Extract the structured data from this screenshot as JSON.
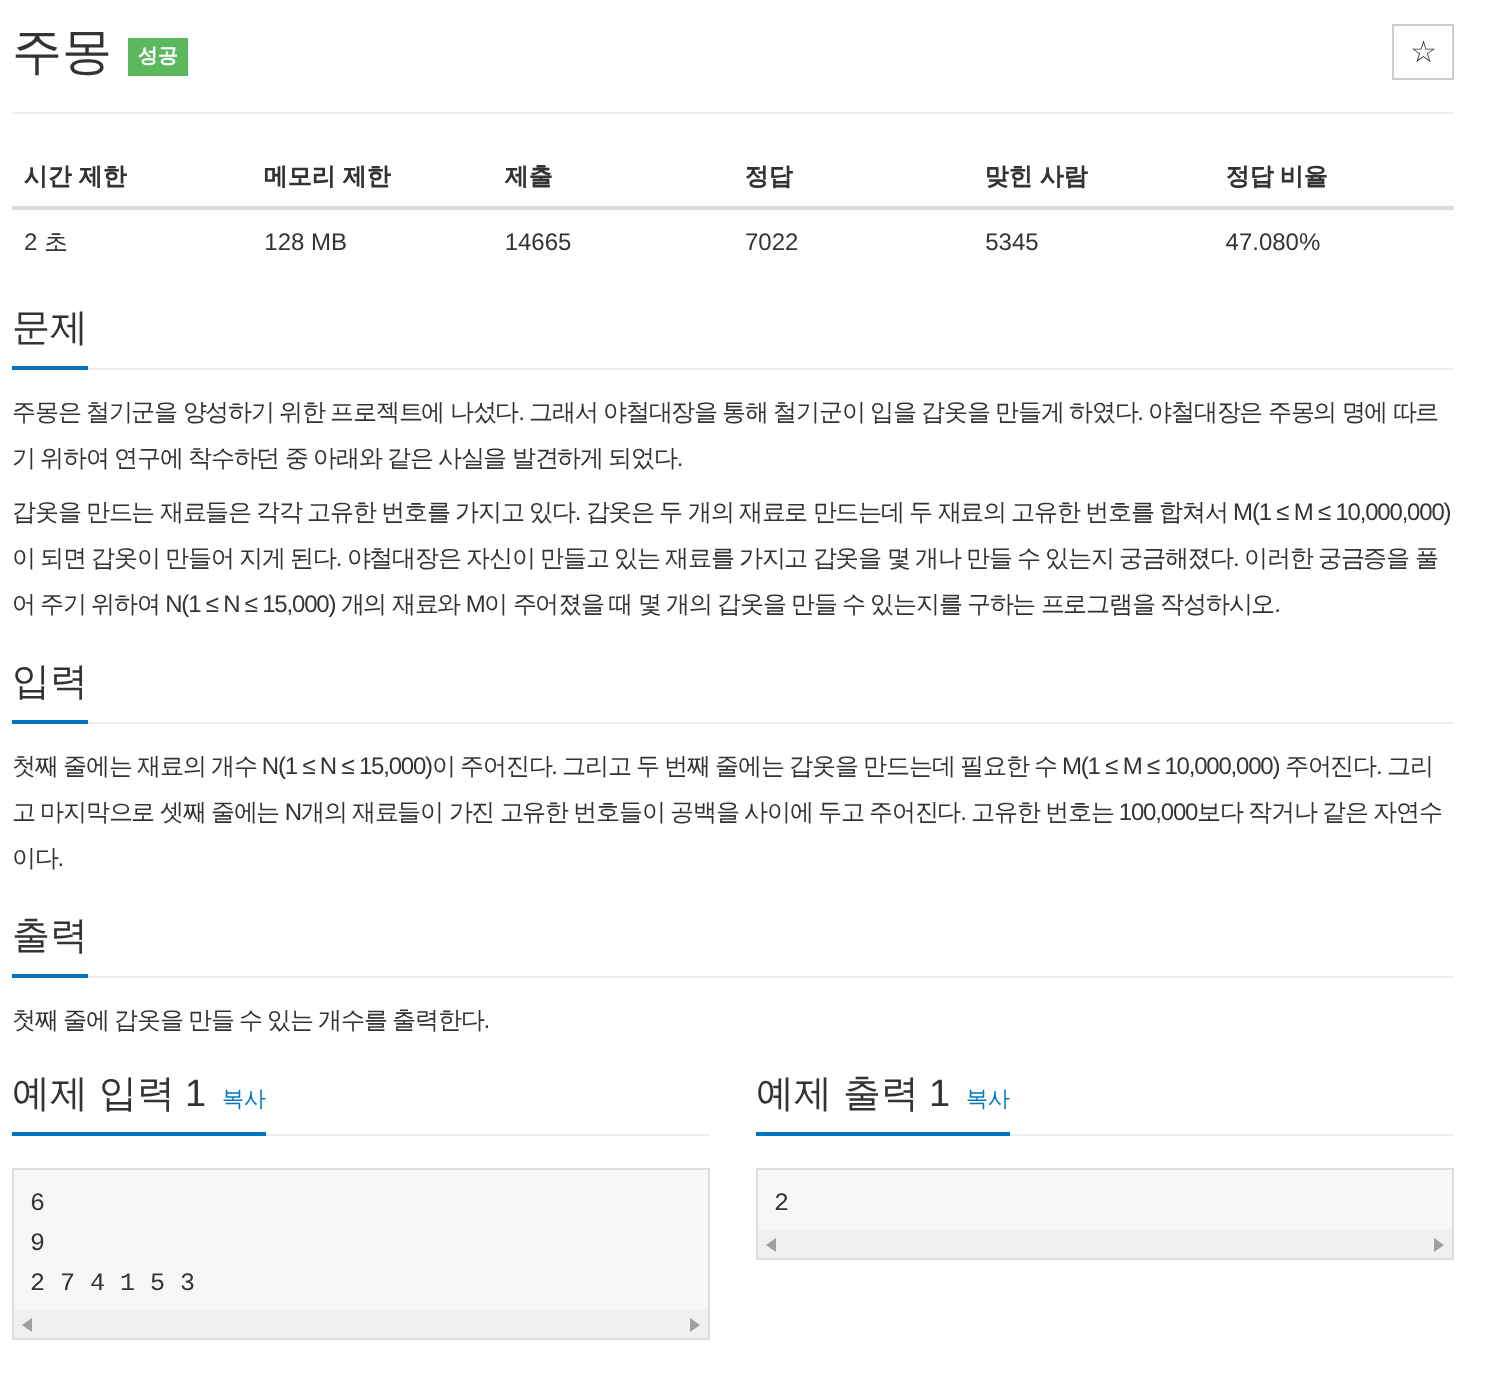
{
  "problem": {
    "title": "주몽",
    "badge": "성공",
    "star": "☆"
  },
  "stats": {
    "columns": [
      "시간 제한",
      "메모리 제한",
      "제출",
      "정답",
      "맞힌 사람",
      "정답 비율"
    ],
    "values": [
      "2 초",
      "128 MB",
      "14665",
      "7022",
      "5345",
      "47.080%"
    ]
  },
  "sections": [
    {
      "heading": "문제",
      "paragraphs": [
        "주몽은 철기군을 양성하기 위한 프로젝트에 나섰다. 그래서 야철대장을 통해 철기군이 입을 갑옷을 만들게 하였다. 야철대장은 주몽의 명에 따르기 위하여 연구에 착수하던 중 아래와 같은 사실을 발견하게 되었다.",
        "갑옷을 만드는 재료들은 각각 고유한 번호를 가지고 있다. 갑옷은 두 개의 재료로 만드는데 두 재료의 고유한 번호를 합쳐서 M(1 ≤ M ≤ 10,000,000)이 되면 갑옷이 만들어 지게 된다. 야철대장은 자신이 만들고 있는 재료를 가지고 갑옷을 몇 개나 만들 수 있는지 궁금해졌다. 이러한 궁금증을 풀어 주기 위하여 N(1 ≤ N ≤ 15,000) 개의 재료와 M이 주어졌을 때 몇 개의 갑옷을 만들 수 있는지를 구하는 프로그램을 작성하시오."
      ]
    },
    {
      "heading": "입력",
      "paragraphs": [
        "첫째 줄에는 재료의 개수 N(1 ≤ N ≤ 15,000)이 주어진다. 그리고 두 번째 줄에는 갑옷을 만드는데 필요한 수 M(1 ≤ M ≤ 10,000,000) 주어진다. 그리고 마지막으로 셋째 줄에는 N개의 재료들이 가진 고유한 번호들이 공백을 사이에 두고 주어진다. 고유한 번호는 100,000보다 작거나 같은 자연수이다."
      ]
    },
    {
      "heading": "출력",
      "paragraphs": [
        "첫째 줄에 갑옷을 만들 수 있는 개수를 출력한다."
      ]
    }
  ],
  "samples": [
    {
      "heading": "예제 입력 1",
      "copy": "복사",
      "lines": [
        "6",
        "9",
        "2 7 4 1 5 3"
      ]
    },
    {
      "heading": "예제 출력 1",
      "copy": "복사",
      "lines": [
        "2"
      ]
    }
  ]
}
